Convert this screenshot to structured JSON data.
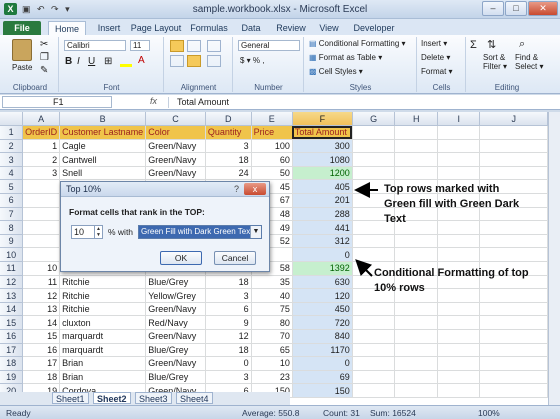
{
  "window": {
    "title": "sample.workbook.xlsx - Microsoft Excel",
    "qat": "▣ ↶ ↷ ▾"
  },
  "tabs": [
    "File",
    "Home",
    "Insert",
    "Page Layout",
    "Formulas",
    "Data",
    "Review",
    "View",
    "Developer"
  ],
  "ribbon": {
    "clipboard": {
      "paste": "Paste",
      "label": "Clipboard"
    },
    "font": {
      "name": "Calibri",
      "size": "11",
      "label": "Font",
      "bold": "B",
      "italic": "I",
      "underline": "U"
    },
    "alignment": {
      "label": "Alignment"
    },
    "number": {
      "format": "General",
      "currency": "$ ▾ % ,",
      "label": "Number"
    },
    "styles": {
      "cond": "Conditional Formatting ▾",
      "table": "Format as Table ▾",
      "cell": "Cell Styles ▾",
      "label": "Styles"
    },
    "cells": {
      "insert": "Insert ▾",
      "delete": "Delete ▾",
      "format": "Format ▾",
      "label": "Cells"
    },
    "editing": {
      "sort": "Sort &",
      "sort2": "Filter ▾",
      "find": "Find &",
      "find2": "Select ▾",
      "label": "Editing"
    }
  },
  "formula_bar": {
    "name_box": "F1",
    "fx": "fx",
    "value": "Total Amount"
  },
  "columns": [
    "A",
    "B",
    "C",
    "D",
    "E",
    "F",
    "G",
    "H",
    "I",
    "J"
  ],
  "header_row": {
    "a": "OrderID",
    "b": "Customer Lastname",
    "c": "Color",
    "d": "Quantity",
    "e": "Price",
    "f": "Total Amount"
  },
  "rows": [
    {
      "n": "2",
      "a": "1",
      "b": "Cagle",
      "c": "Green/Navy",
      "d": "3",
      "e": "100",
      "f": "300",
      "hl": false
    },
    {
      "n": "3",
      "a": "2",
      "b": "Cantwell",
      "c": "Green/Navy",
      "d": "18",
      "e": "60",
      "f": "1080",
      "hl": false
    },
    {
      "n": "4",
      "a": "3",
      "b": "Snell",
      "c": "Green/Navy",
      "d": "24",
      "e": "50",
      "f": "1200",
      "hl": true
    },
    {
      "n": "5",
      "a": "",
      "b": "",
      "c": "",
      "d": "",
      "e": "45",
      "f": "405",
      "hl": false
    },
    {
      "n": "6",
      "a": "",
      "b": "",
      "c": "",
      "d": "",
      "e": "67",
      "f": "201",
      "hl": false
    },
    {
      "n": "7",
      "a": "",
      "b": "",
      "c": "",
      "d": "",
      "e": "48",
      "f": "288",
      "hl": false
    },
    {
      "n": "8",
      "a": "",
      "b": "",
      "c": "",
      "d": "",
      "e": "49",
      "f": "441",
      "hl": false
    },
    {
      "n": "9",
      "a": "",
      "b": "",
      "c": "",
      "d": "",
      "e": "52",
      "f": "312",
      "hl": false
    },
    {
      "n": "10",
      "a": "",
      "b": "",
      "c": "",
      "d": "",
      "e": "",
      "f": "0",
      "hl": false
    },
    {
      "n": "11",
      "a": "10",
      "b": "",
      "c": "",
      "d": "",
      "e": "58",
      "f": "1392",
      "hl": true
    },
    {
      "n": "12",
      "a": "11",
      "b": "Ritchie",
      "c": "Blue/Grey",
      "d": "18",
      "e": "35",
      "f": "630",
      "hl": false
    },
    {
      "n": "13",
      "a": "12",
      "b": "Ritchie",
      "c": "Yellow/Grey",
      "d": "3",
      "e": "40",
      "f": "120",
      "hl": false
    },
    {
      "n": "14",
      "a": "13",
      "b": "Ritchie",
      "c": "Green/Navy",
      "d": "6",
      "e": "75",
      "f": "450",
      "hl": false
    },
    {
      "n": "15",
      "a": "14",
      "b": "cluxton",
      "c": "Red/Navy",
      "d": "9",
      "e": "80",
      "f": "720",
      "hl": false
    },
    {
      "n": "16",
      "a": "15",
      "b": "marquardt",
      "c": "Green/Navy",
      "d": "12",
      "e": "70",
      "f": "840",
      "hl": false
    },
    {
      "n": "17",
      "a": "16",
      "b": "marquardt",
      "c": "Blue/Grey",
      "d": "18",
      "e": "65",
      "f": "1170",
      "hl": false
    },
    {
      "n": "18",
      "a": "17",
      "b": "Brian",
      "c": "Green/Navy",
      "d": "0",
      "e": "10",
      "f": "0",
      "hl": false
    },
    {
      "n": "19",
      "a": "18",
      "b": "Brian",
      "c": "Blue/Grey",
      "d": "3",
      "e": "23",
      "f": "69",
      "hl": false
    },
    {
      "n": "20",
      "a": "19",
      "b": "Cordova",
      "c": "Green/Navy",
      "d": "6",
      "e": "150",
      "f": "150",
      "hl": false
    }
  ],
  "sheets": [
    "Sheet1",
    "Sheet2",
    "Sheet3",
    "Sheet4"
  ],
  "status": {
    "ready": "Ready",
    "average": "Average: 550.8",
    "count": "Count: 31",
    "sum": "Sum: 16524",
    "zoom": "100%"
  },
  "dialog": {
    "title": "Top 10%",
    "help": "?",
    "close": "x",
    "prompt": "Format cells that rank in the TOP:",
    "value": "10",
    "with_label": "% with",
    "format": "Green Fill with Dark Green Text",
    "ok": "OK",
    "cancel": "Cancel"
  },
  "annotations": {
    "top": "Top rows marked with Green fill with Green Dark Text",
    "bottom": "Conditional Formatting of top 10% rows"
  },
  "colors": {
    "header_fill": "#f0c44a",
    "highlight_fill": "#c6efce",
    "highlight_text": "#006100",
    "file_tab": "#2a7a3f"
  }
}
